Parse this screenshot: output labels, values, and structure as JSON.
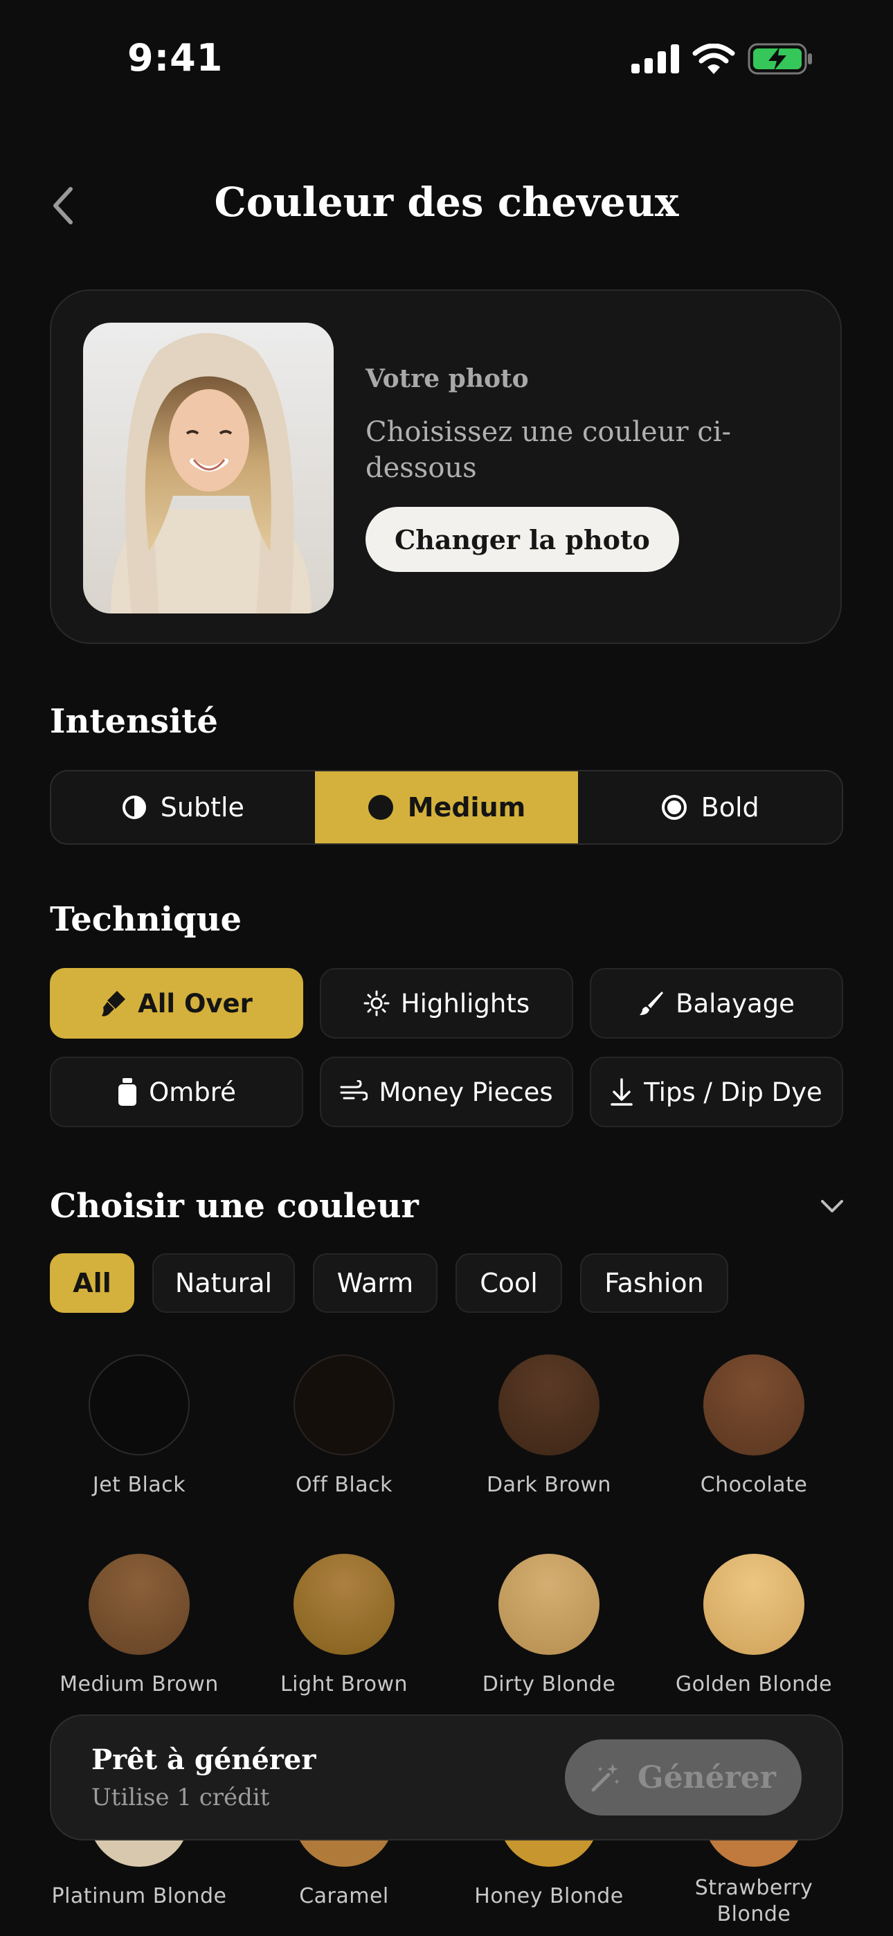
{
  "status_bar": {
    "time": "9:41"
  },
  "header": {
    "title": "Couleur des cheveux"
  },
  "photo_card": {
    "label": "Votre photo",
    "hint": "Choisissez une couleur ci-dessous",
    "change_button": "Changer la photo"
  },
  "intensity": {
    "heading": "Intensité",
    "options": [
      {
        "label": "Subtle",
        "icon": "half-circle-icon",
        "selected": false
      },
      {
        "label": "Medium",
        "icon": "filled-circle-icon",
        "selected": true
      },
      {
        "label": "Bold",
        "icon": "ring-dot-icon",
        "selected": false
      }
    ]
  },
  "technique": {
    "heading": "Technique",
    "options": [
      {
        "label": "All Over",
        "icon": "brush-icon",
        "selected": true
      },
      {
        "label": "Highlights",
        "icon": "sun-icon",
        "selected": false
      },
      {
        "label": "Balayage",
        "icon": "paintbrush-icon",
        "selected": false
      },
      {
        "label": "Ombré",
        "icon": "bottle-icon",
        "selected": false
      },
      {
        "label": "Money Pieces",
        "icon": "wind-icon",
        "selected": false
      },
      {
        "label": "Tips / Dip Dye",
        "icon": "arrow-down-icon",
        "selected": false
      }
    ]
  },
  "colors": {
    "heading": "Choisir une couleur",
    "filters": [
      {
        "label": "All",
        "selected": true
      },
      {
        "label": "Natural",
        "selected": false
      },
      {
        "label": "Warm",
        "selected": false
      },
      {
        "label": "Cool",
        "selected": false
      },
      {
        "label": "Fashion",
        "selected": false
      }
    ],
    "swatches": [
      {
        "name": "Jet Black",
        "color": "#0b0b0b"
      },
      {
        "name": "Off Black",
        "color": "#150f0c"
      },
      {
        "name": "Dark Brown",
        "color": "#4a3020"
      },
      {
        "name": "Chocolate",
        "color": "#6a4128"
      },
      {
        "name": "Medium Brown",
        "color": "#7a5230"
      },
      {
        "name": "Light Brown",
        "color": "#9c7030"
      },
      {
        "name": "Dirty Blonde",
        "color": "#c8a060"
      },
      {
        "name": "Golden Blonde",
        "color": "#dfb66a"
      },
      {
        "name": "Platinum Blonde",
        "color": "#d8c8ae"
      },
      {
        "name": "Caramel",
        "color": "#b07a3a"
      },
      {
        "name": "Honey Blonde",
        "color": "#c8962e"
      },
      {
        "name": "Strawberry Blonde",
        "color": "#c07a3e"
      }
    ]
  },
  "bottom_bar": {
    "title": "Prêt à générer",
    "subtitle": "Utilise 1 crédit",
    "generate_button": "Générer"
  },
  "accent_color": "#d4b13c"
}
